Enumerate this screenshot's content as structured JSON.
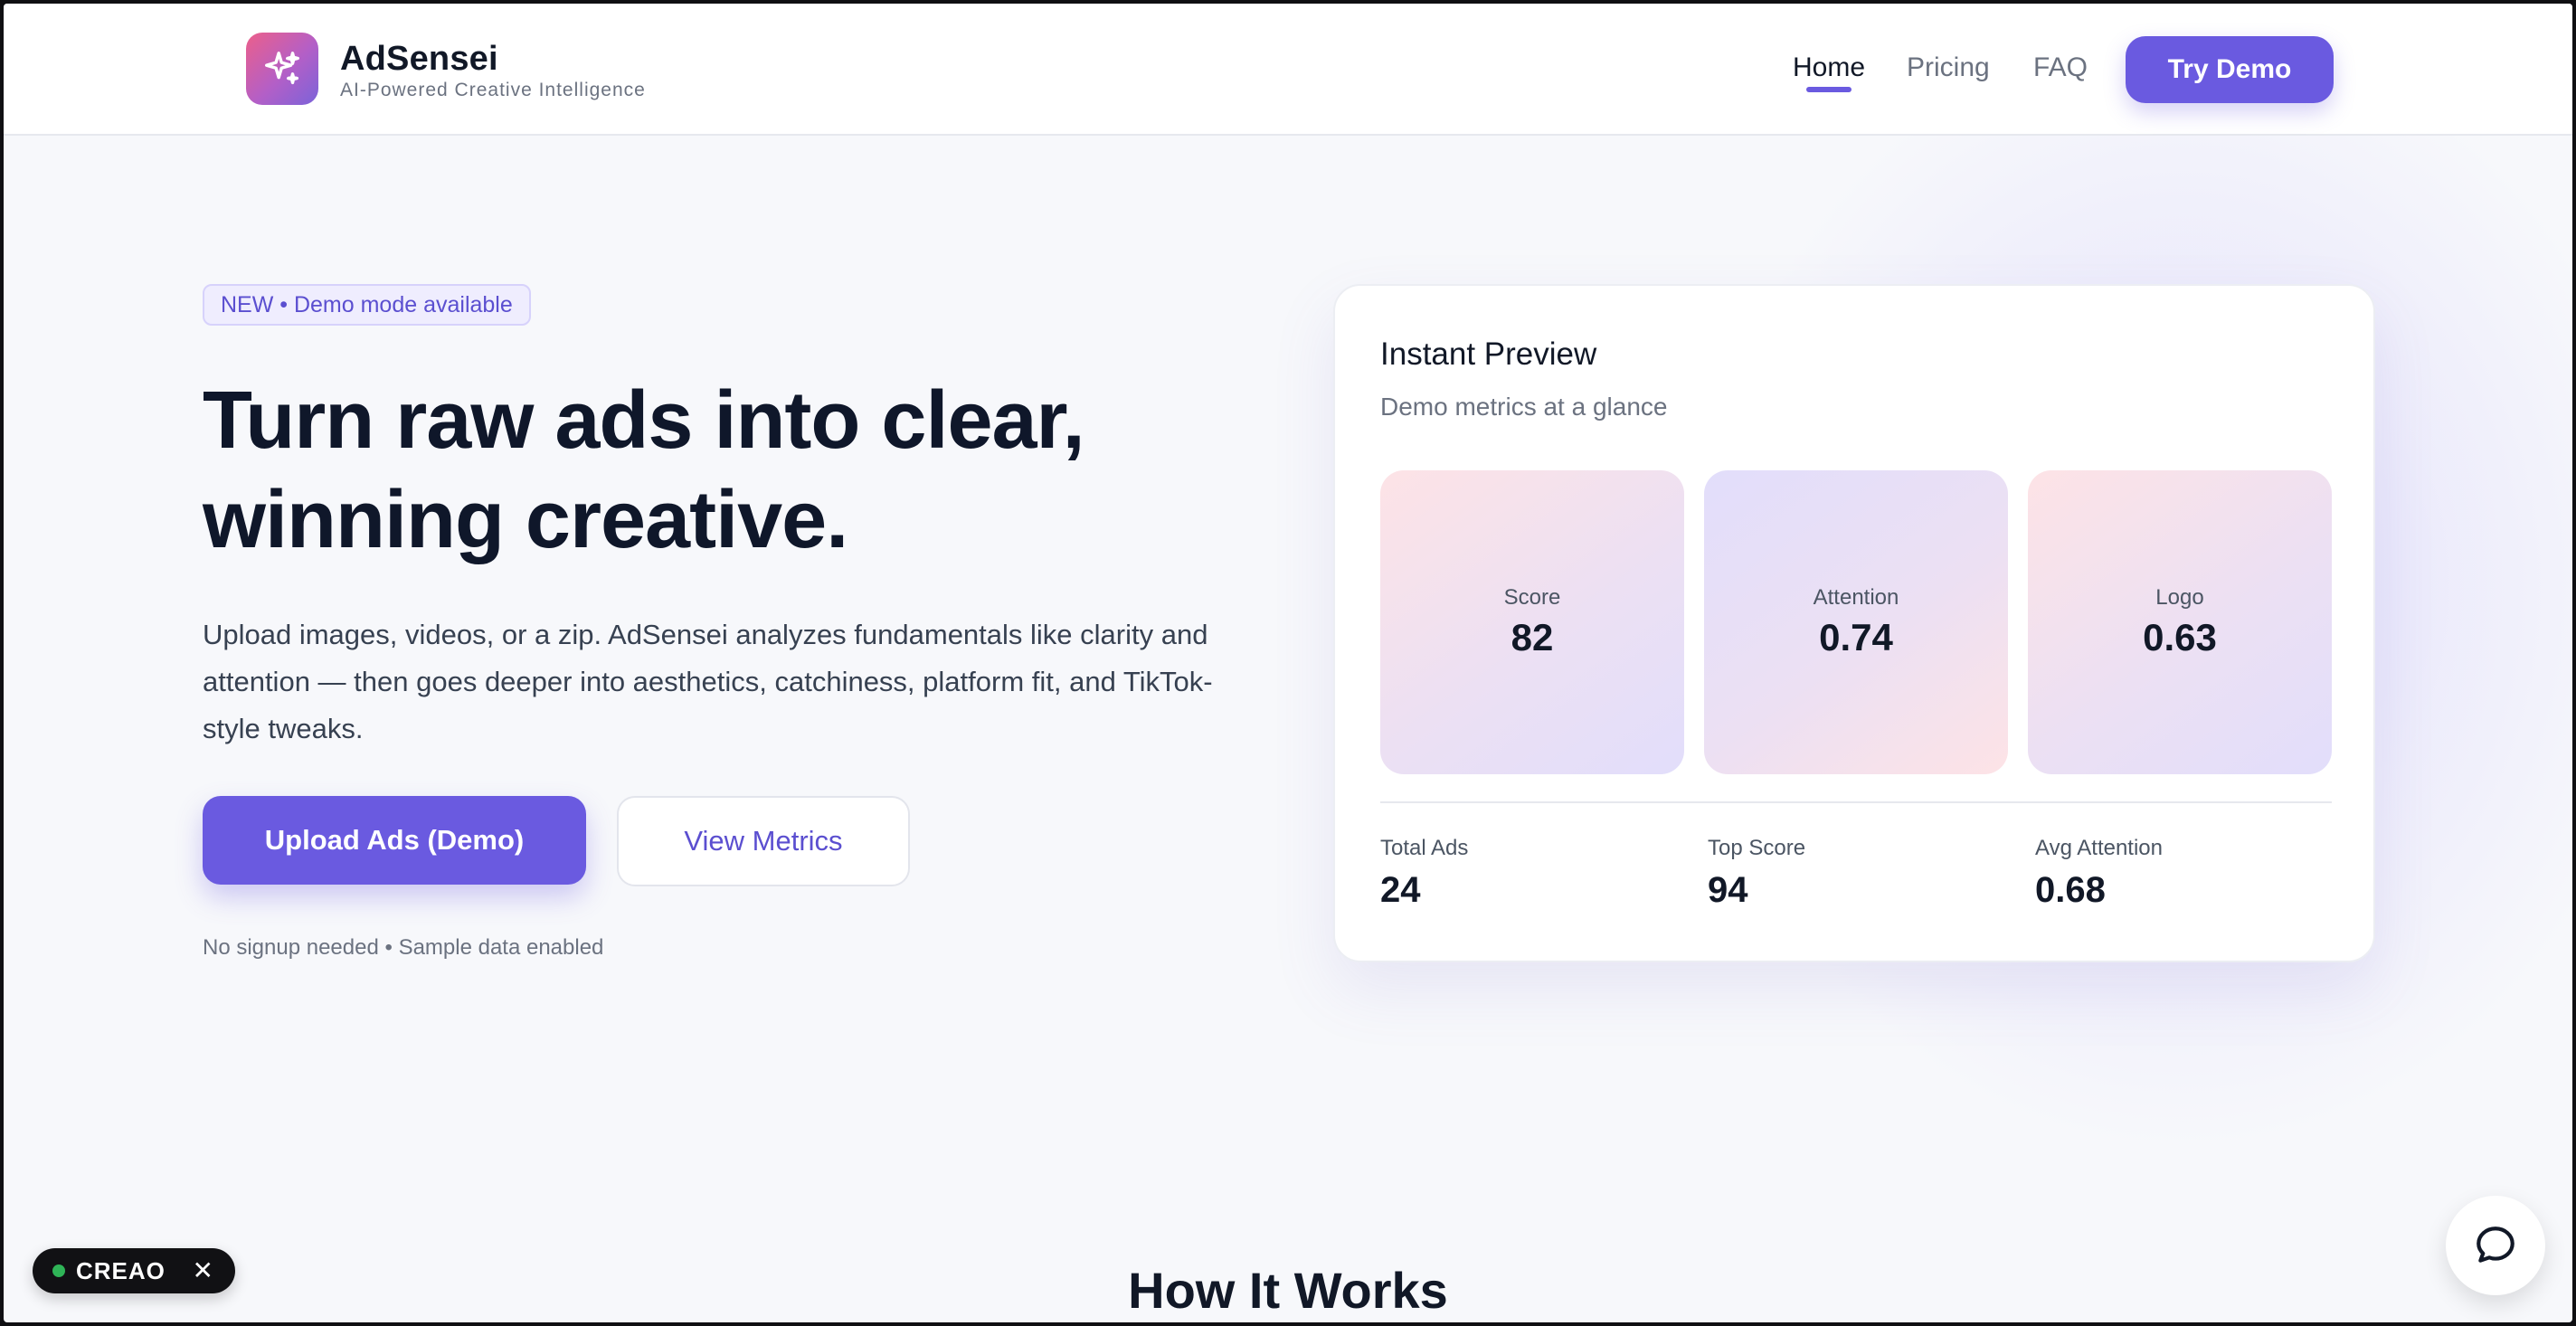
{
  "brand": {
    "name": "AdSensei",
    "tagline": "AI-Powered Creative Intelligence",
    "logo_icon": "sparkle-icon"
  },
  "nav": {
    "items": [
      {
        "label": "Home",
        "active": true
      },
      {
        "label": "Pricing"
      },
      {
        "label": "FAQ"
      }
    ],
    "cta": "Try Demo"
  },
  "hero": {
    "badge": "NEW • Demo mode available",
    "headline_line1": "Turn raw ads into clear,",
    "headline_line2": "winning creative.",
    "description": "Upload images, videos, or a zip. AdSensei analyzes fundamentals like clarity and attention — then goes deeper into aesthetics, catchiness, platform fit, and TikTok-style tweaks.",
    "primary_button": "Upload Ads (Demo)",
    "secondary_button": "View Metrics",
    "note": "No signup needed • Sample data enabled"
  },
  "preview": {
    "title": "Instant Preview",
    "subtitle": "Demo metrics at a glance",
    "metrics": [
      {
        "label": "Score",
        "value": "82"
      },
      {
        "label": "Attention",
        "value": "0.74"
      },
      {
        "label": "Logo",
        "value": "0.63"
      }
    ],
    "stats": [
      {
        "label": "Total Ads",
        "value": "24"
      },
      {
        "label": "Top Score",
        "value": "94"
      },
      {
        "label": "Avg Attention",
        "value": "0.68"
      }
    ]
  },
  "section": {
    "how_it_works": "How It Works"
  },
  "widget": {
    "label": "CREAO",
    "chat_icon": "chat-bubble-icon",
    "close_icon": "close-icon"
  },
  "colors": {
    "accent": "#6a5ae0",
    "background": "#f7f8fb",
    "status_dot": "#2fb457"
  }
}
